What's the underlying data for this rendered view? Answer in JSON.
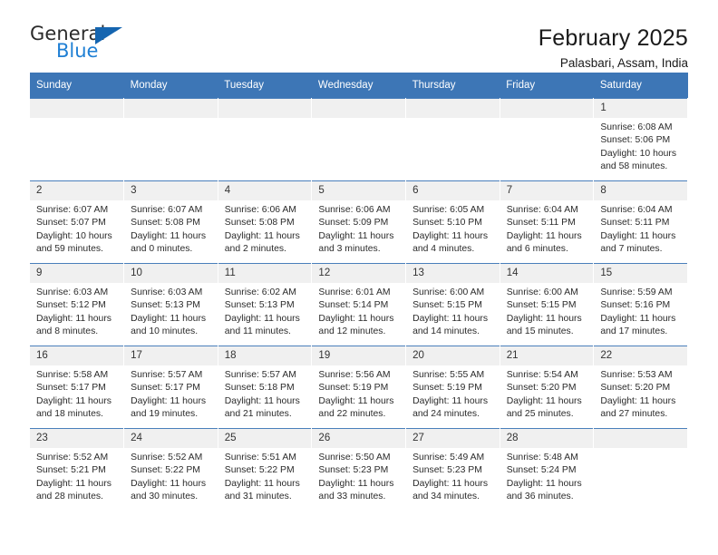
{
  "logo": {
    "line1": "General",
    "line2": "Blue",
    "triangle_color": "#1565b0",
    "blue_color": "#1f7fd4"
  },
  "header": {
    "title": "February 2025",
    "subtitle": "Palasbari, Assam, India"
  },
  "theme": {
    "header_blue": "#3d76b6",
    "daynum_gray": "#f0f0f0",
    "grid_line": "#4a7fbb"
  },
  "weekdays": [
    "Sunday",
    "Monday",
    "Tuesday",
    "Wednesday",
    "Thursday",
    "Friday",
    "Saturday"
  ],
  "labels": {
    "sunrise": "Sunrise:",
    "sunset": "Sunset:",
    "daylight": "Daylight:"
  },
  "weeks": [
    [
      {
        "day": "",
        "sunrise": "",
        "sunset": "",
        "daylight_1": "",
        "daylight_2": ""
      },
      {
        "day": "",
        "sunrise": "",
        "sunset": "",
        "daylight_1": "",
        "daylight_2": ""
      },
      {
        "day": "",
        "sunrise": "",
        "sunset": "",
        "daylight_1": "",
        "daylight_2": ""
      },
      {
        "day": "",
        "sunrise": "",
        "sunset": "",
        "daylight_1": "",
        "daylight_2": ""
      },
      {
        "day": "",
        "sunrise": "",
        "sunset": "",
        "daylight_1": "",
        "daylight_2": ""
      },
      {
        "day": "",
        "sunrise": "",
        "sunset": "",
        "daylight_1": "",
        "daylight_2": ""
      },
      {
        "day": "1",
        "sunrise": "Sunrise: 6:08 AM",
        "sunset": "Sunset: 5:06 PM",
        "daylight_1": "Daylight: 10 hours",
        "daylight_2": "and 58 minutes."
      }
    ],
    [
      {
        "day": "2",
        "sunrise": "Sunrise: 6:07 AM",
        "sunset": "Sunset: 5:07 PM",
        "daylight_1": "Daylight: 10 hours",
        "daylight_2": "and 59 minutes."
      },
      {
        "day": "3",
        "sunrise": "Sunrise: 6:07 AM",
        "sunset": "Sunset: 5:08 PM",
        "daylight_1": "Daylight: 11 hours",
        "daylight_2": "and 0 minutes."
      },
      {
        "day": "4",
        "sunrise": "Sunrise: 6:06 AM",
        "sunset": "Sunset: 5:08 PM",
        "daylight_1": "Daylight: 11 hours",
        "daylight_2": "and 2 minutes."
      },
      {
        "day": "5",
        "sunrise": "Sunrise: 6:06 AM",
        "sunset": "Sunset: 5:09 PM",
        "daylight_1": "Daylight: 11 hours",
        "daylight_2": "and 3 minutes."
      },
      {
        "day": "6",
        "sunrise": "Sunrise: 6:05 AM",
        "sunset": "Sunset: 5:10 PM",
        "daylight_1": "Daylight: 11 hours",
        "daylight_2": "and 4 minutes."
      },
      {
        "day": "7",
        "sunrise": "Sunrise: 6:04 AM",
        "sunset": "Sunset: 5:11 PM",
        "daylight_1": "Daylight: 11 hours",
        "daylight_2": "and 6 minutes."
      },
      {
        "day": "8",
        "sunrise": "Sunrise: 6:04 AM",
        "sunset": "Sunset: 5:11 PM",
        "daylight_1": "Daylight: 11 hours",
        "daylight_2": "and 7 minutes."
      }
    ],
    [
      {
        "day": "9",
        "sunrise": "Sunrise: 6:03 AM",
        "sunset": "Sunset: 5:12 PM",
        "daylight_1": "Daylight: 11 hours",
        "daylight_2": "and 8 minutes."
      },
      {
        "day": "10",
        "sunrise": "Sunrise: 6:03 AM",
        "sunset": "Sunset: 5:13 PM",
        "daylight_1": "Daylight: 11 hours",
        "daylight_2": "and 10 minutes."
      },
      {
        "day": "11",
        "sunrise": "Sunrise: 6:02 AM",
        "sunset": "Sunset: 5:13 PM",
        "daylight_1": "Daylight: 11 hours",
        "daylight_2": "and 11 minutes."
      },
      {
        "day": "12",
        "sunrise": "Sunrise: 6:01 AM",
        "sunset": "Sunset: 5:14 PM",
        "daylight_1": "Daylight: 11 hours",
        "daylight_2": "and 12 minutes."
      },
      {
        "day": "13",
        "sunrise": "Sunrise: 6:00 AM",
        "sunset": "Sunset: 5:15 PM",
        "daylight_1": "Daylight: 11 hours",
        "daylight_2": "and 14 minutes."
      },
      {
        "day": "14",
        "sunrise": "Sunrise: 6:00 AM",
        "sunset": "Sunset: 5:15 PM",
        "daylight_1": "Daylight: 11 hours",
        "daylight_2": "and 15 minutes."
      },
      {
        "day": "15",
        "sunrise": "Sunrise: 5:59 AM",
        "sunset": "Sunset: 5:16 PM",
        "daylight_1": "Daylight: 11 hours",
        "daylight_2": "and 17 minutes."
      }
    ],
    [
      {
        "day": "16",
        "sunrise": "Sunrise: 5:58 AM",
        "sunset": "Sunset: 5:17 PM",
        "daylight_1": "Daylight: 11 hours",
        "daylight_2": "and 18 minutes."
      },
      {
        "day": "17",
        "sunrise": "Sunrise: 5:57 AM",
        "sunset": "Sunset: 5:17 PM",
        "daylight_1": "Daylight: 11 hours",
        "daylight_2": "and 19 minutes."
      },
      {
        "day": "18",
        "sunrise": "Sunrise: 5:57 AM",
        "sunset": "Sunset: 5:18 PM",
        "daylight_1": "Daylight: 11 hours",
        "daylight_2": "and 21 minutes."
      },
      {
        "day": "19",
        "sunrise": "Sunrise: 5:56 AM",
        "sunset": "Sunset: 5:19 PM",
        "daylight_1": "Daylight: 11 hours",
        "daylight_2": "and 22 minutes."
      },
      {
        "day": "20",
        "sunrise": "Sunrise: 5:55 AM",
        "sunset": "Sunset: 5:19 PM",
        "daylight_1": "Daylight: 11 hours",
        "daylight_2": "and 24 minutes."
      },
      {
        "day": "21",
        "sunrise": "Sunrise: 5:54 AM",
        "sunset": "Sunset: 5:20 PM",
        "daylight_1": "Daylight: 11 hours",
        "daylight_2": "and 25 minutes."
      },
      {
        "day": "22",
        "sunrise": "Sunrise: 5:53 AM",
        "sunset": "Sunset: 5:20 PM",
        "daylight_1": "Daylight: 11 hours",
        "daylight_2": "and 27 minutes."
      }
    ],
    [
      {
        "day": "23",
        "sunrise": "Sunrise: 5:52 AM",
        "sunset": "Sunset: 5:21 PM",
        "daylight_1": "Daylight: 11 hours",
        "daylight_2": "and 28 minutes."
      },
      {
        "day": "24",
        "sunrise": "Sunrise: 5:52 AM",
        "sunset": "Sunset: 5:22 PM",
        "daylight_1": "Daylight: 11 hours",
        "daylight_2": "and 30 minutes."
      },
      {
        "day": "25",
        "sunrise": "Sunrise: 5:51 AM",
        "sunset": "Sunset: 5:22 PM",
        "daylight_1": "Daylight: 11 hours",
        "daylight_2": "and 31 minutes."
      },
      {
        "day": "26",
        "sunrise": "Sunrise: 5:50 AM",
        "sunset": "Sunset: 5:23 PM",
        "daylight_1": "Daylight: 11 hours",
        "daylight_2": "and 33 minutes."
      },
      {
        "day": "27",
        "sunrise": "Sunrise: 5:49 AM",
        "sunset": "Sunset: 5:23 PM",
        "daylight_1": "Daylight: 11 hours",
        "daylight_2": "and 34 minutes."
      },
      {
        "day": "28",
        "sunrise": "Sunrise: 5:48 AM",
        "sunset": "Sunset: 5:24 PM",
        "daylight_1": "Daylight: 11 hours",
        "daylight_2": "and 36 minutes."
      },
      {
        "day": "",
        "sunrise": "",
        "sunset": "",
        "daylight_1": "",
        "daylight_2": ""
      }
    ]
  ]
}
